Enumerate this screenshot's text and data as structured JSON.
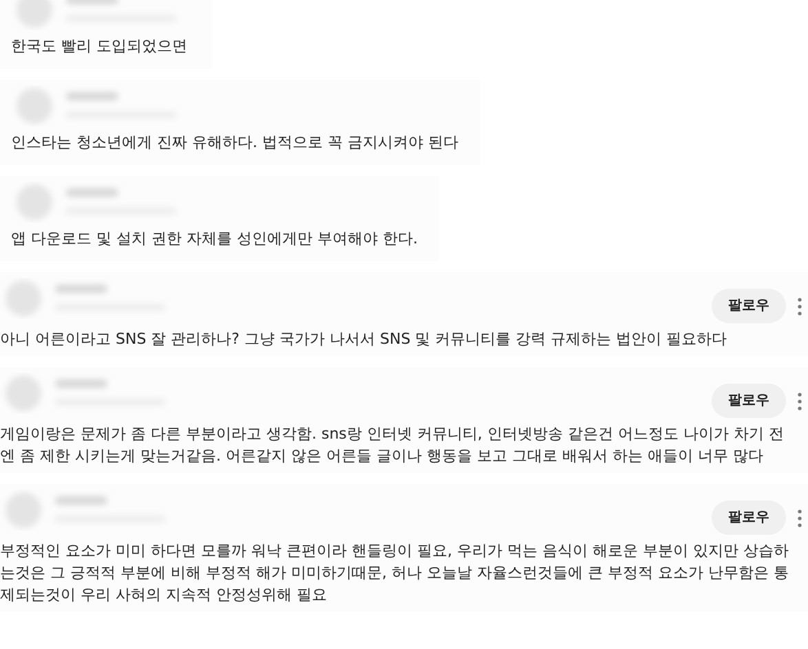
{
  "comments": [
    {
      "kind": "plain",
      "lines": [
        "한국도 빨리 도입되었으면"
      ]
    },
    {
      "kind": "plain",
      "lines": [
        "인스타는 청소년에게 진짜 유해하다. 법적으로 꼭 금지시켜야 된다"
      ]
    },
    {
      "kind": "plain",
      "lines": [
        "앱 다운로드 및 설치 권한 자체를 성인에게만 부여해야 한다."
      ]
    },
    {
      "kind": "followable",
      "follow": "팔로우",
      "lines": [
        "아니 어른이라고 SNS 잘 관리하나? 그냥 국가가 나서서 SNS 및 커뮤니티를 강력 규제하는 법안이 필요하다"
      ]
    },
    {
      "kind": "followable",
      "follow": "팔로우",
      "lines": [
        "게임이랑은 문제가 좀 다른 부분이라고 생각함. sns랑 인터넷 커뮤니티, 인터넷방송 같은건 어느정도 나이가 차기 전",
        "엔 좀 제한 시키는게 맞는거같음. 어른같지 않은 어른들 글이나 행동을 보고 그대로 배워서 하는 애들이 너무 많다"
      ]
    },
    {
      "kind": "followable",
      "follow": "팔로우",
      "lines": [
        "부정적인 요소가 미미 하다면 모를까 워낙 큰편이라 핸들링이 필요, 우리가 먹는 음식이 해로운 부분이 있지만 상습하",
        "는것은 그 긍적적 부분에 비해 부정적 해가 미미하기때문, 허나 오늘날 자율스런것들에 큰 부정적 요소가 난무함은 통",
        "제되는것이 우리 사혀의 지속적 안정성위해 필요"
      ]
    }
  ]
}
